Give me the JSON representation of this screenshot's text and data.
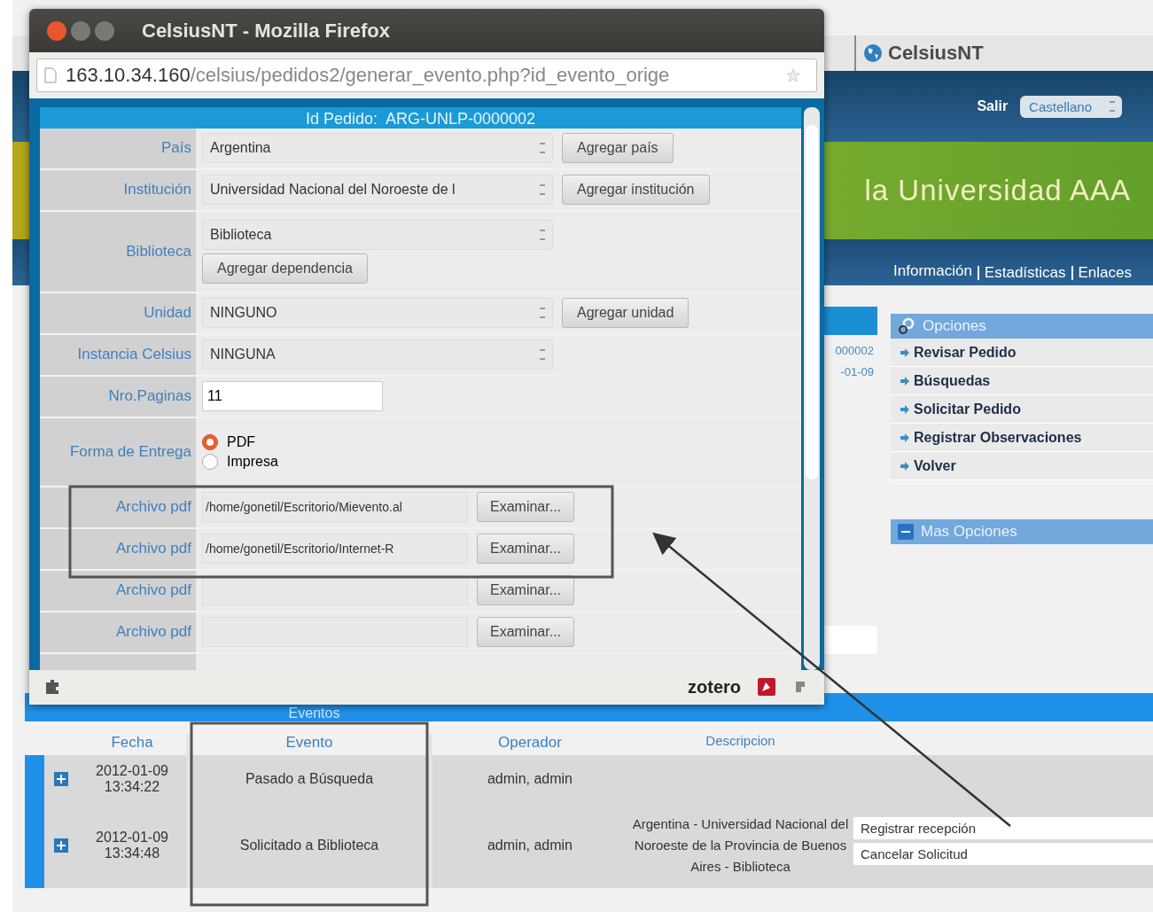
{
  "browser_tab": {
    "label": "CelsiusNT"
  },
  "header": {
    "logout": "Salir",
    "language": "Castellano"
  },
  "banner": {
    "title": "la Universidad AAA"
  },
  "nav": [
    "Información",
    "Estadísticas",
    "Enlaces"
  ],
  "request_summary": [
    "000002",
    "-01-09"
  ],
  "options": {
    "title": "Opciones",
    "items": [
      "Revisar Pedido",
      "Búsquedas",
      "Solicitar Pedido",
      "Registrar Observaciones",
      "Volver"
    ]
  },
  "more_options": {
    "title": "Mas Opciones"
  },
  "events": {
    "title": "Eventos",
    "columns": [
      "Fecha",
      "Evento",
      "Operador",
      "Descripcion"
    ],
    "rows": [
      {
        "date": "2012-01-09",
        "time": "13:34:22",
        "event": "Pasado a Búsqueda",
        "operator": "admin, admin",
        "description": ""
      },
      {
        "date": "2012-01-09",
        "time": "13:34:48",
        "event": "Solicitado a Biblioteca",
        "operator": "admin, admin",
        "description": "Argentina - Universidad Nacional del Noroeste de la Provincia de Buenos Aires - Biblioteca"
      }
    ],
    "actions": [
      "Registrar recepción",
      "Cancelar Solicitud"
    ]
  },
  "popup": {
    "title": "CelsiusNT - Mozilla Firefox",
    "url_host": "163.10.34.160",
    "url_path": "/celsius/pedidos2/generar_evento.php?id_evento_orige",
    "form_title": "Id Pedido:  ARG-UNLP-0000002",
    "fields": [
      {
        "kind": "select",
        "label": "País",
        "value": "Argentina",
        "button": "Agregar país"
      },
      {
        "kind": "select",
        "label": "Institución",
        "value": "Universidad Nacional del Noroeste de l",
        "button": "Agregar institución"
      },
      {
        "kind": "stacked",
        "label": "Biblioteca",
        "value": "Biblioteca",
        "button": "Agregar dependencia"
      },
      {
        "kind": "select",
        "label": "Unidad",
        "value": "NINGUNO",
        "button": "Agregar unidad"
      },
      {
        "kind": "select",
        "label": "Instancia Celsius",
        "value": "NINGUNA"
      },
      {
        "kind": "text",
        "label": "Nro.Paginas",
        "value": "11"
      },
      {
        "kind": "radio",
        "label": "Forma de Entrega",
        "options": [
          {
            "label": "PDF",
            "selected": true
          },
          {
            "label": "Impresa",
            "selected": false
          }
        ]
      },
      {
        "kind": "file",
        "label": "Archivo pdf",
        "value": "/home/gonetil/Escritorio/Mievento.al",
        "button": "Examinar..."
      },
      {
        "kind": "file",
        "label": "Archivo pdf",
        "value": "/home/gonetil/Escritorio/Internet-R",
        "button": "Examinar..."
      },
      {
        "kind": "file",
        "label": "Archivo pdf",
        "button": "Examinar..."
      },
      {
        "kind": "file",
        "label": "Archivo pdf",
        "button": "Examinar..."
      }
    ],
    "status": "zotero"
  }
}
